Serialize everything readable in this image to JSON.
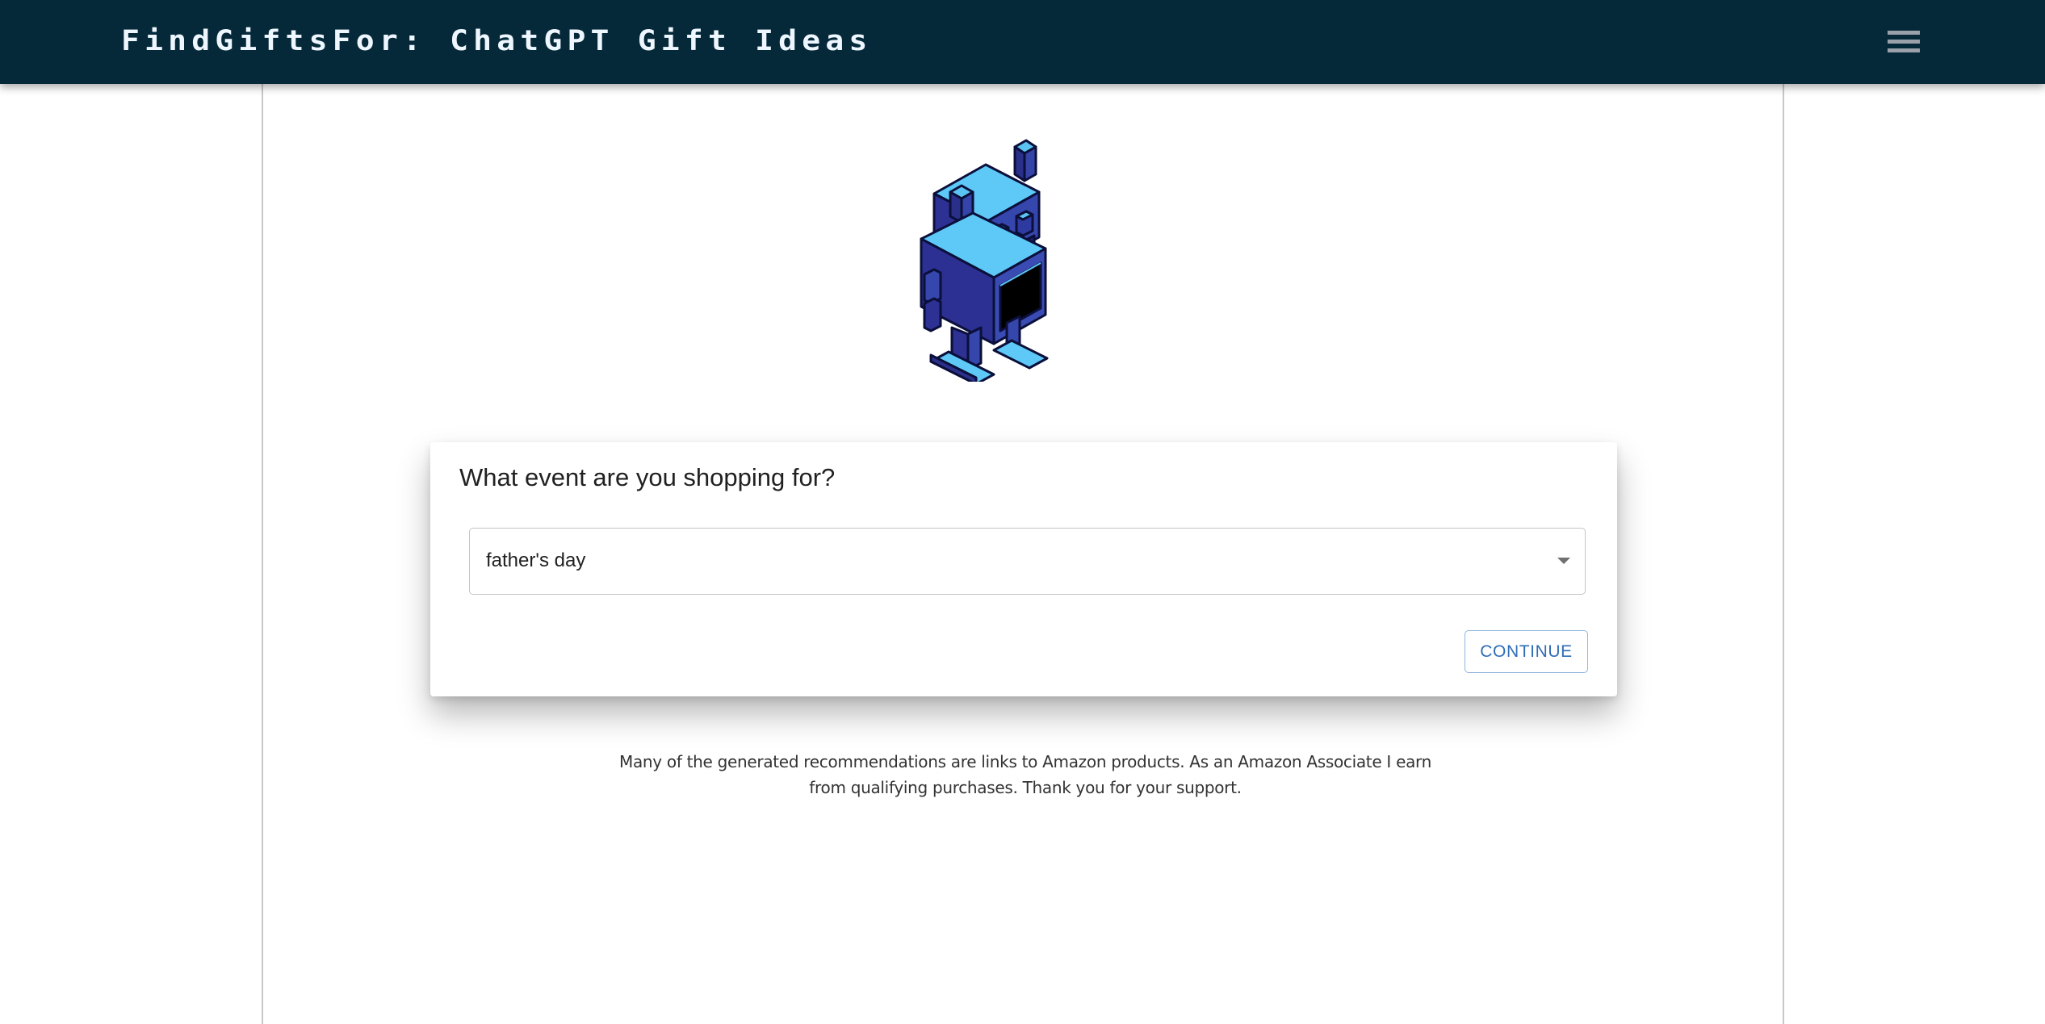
{
  "header": {
    "title": "FindGiftsFor: ChatGPT Gift Ideas",
    "menu_icon": "hamburger-menu-icon",
    "background_color": "#052939"
  },
  "hero": {
    "image": "robot-mascot-illustration"
  },
  "question_card": {
    "question": "What event are you shopping for?",
    "event_select": {
      "selected_value": "father's day",
      "icon": "dropdown-caret-icon"
    },
    "continue_label": "CONTINUE",
    "accent_color": "#2f6db5"
  },
  "footer": {
    "disclaimer": "Many of the generated recommendations are links to Amazon products. As an Amazon Associate I earn from qualifying purchases. Thank you for your support."
  }
}
